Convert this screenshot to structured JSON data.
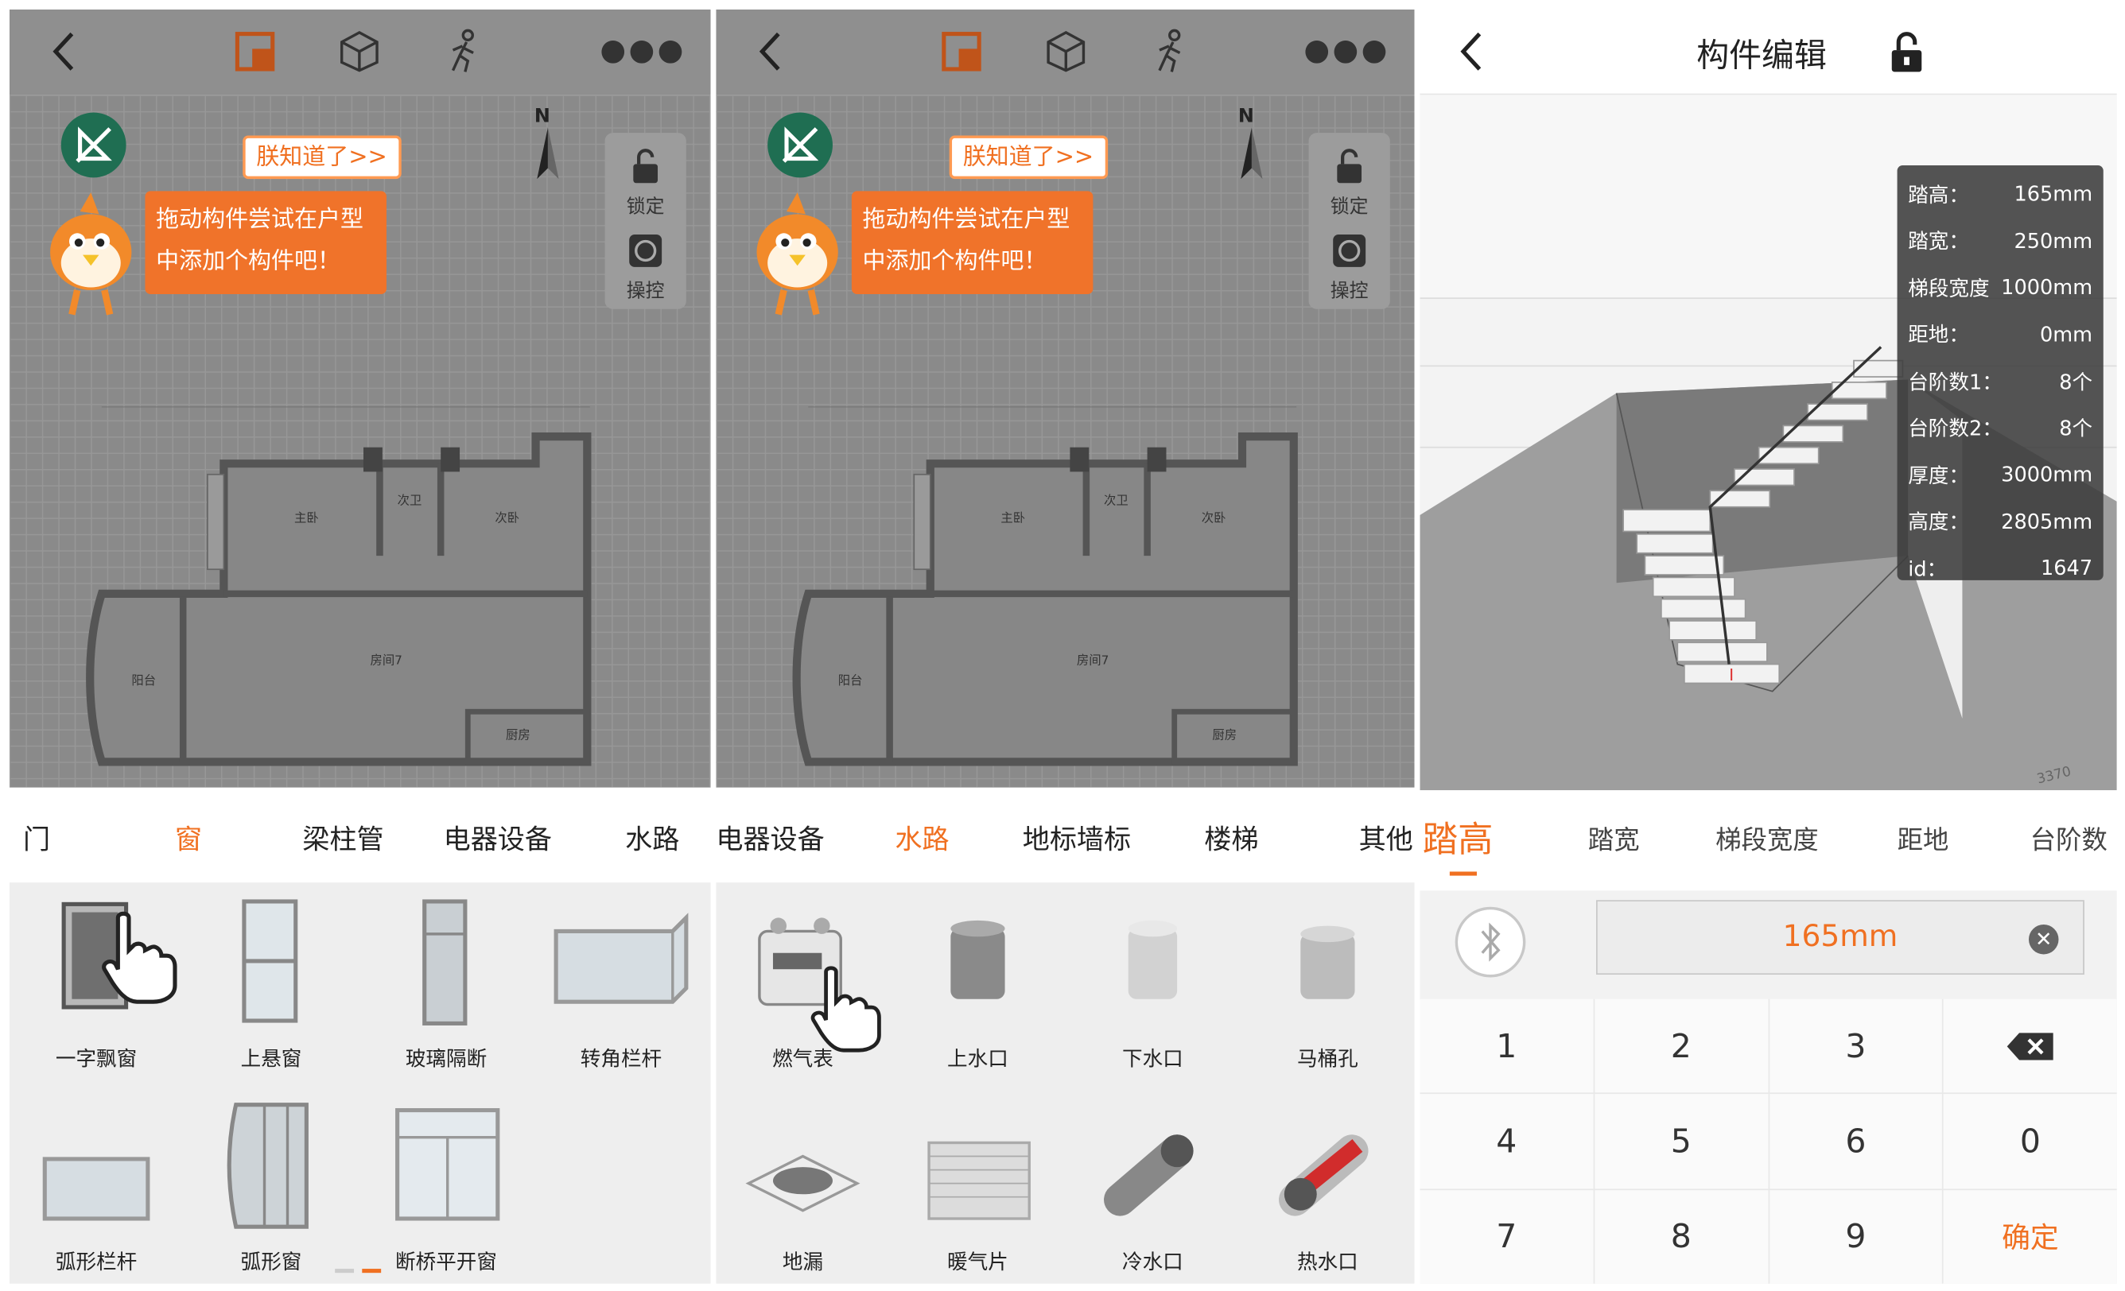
{
  "panel1": {
    "know": "朕知道了>>",
    "bubble": [
      "拖动构件尝试在户型",
      "中添加个构件吧！"
    ],
    "side": {
      "lock": "锁定",
      "control": "操控"
    },
    "north": "N",
    "plan_labels": {
      "master": "主卧",
      "guest_bath": "次卫",
      "guest_bed": "次卧",
      "room7": "房间7",
      "balcony": "阳台",
      "kitchen": "厨房"
    },
    "categories": [
      "门",
      "窗",
      "梁柱管",
      "电器设备",
      "水路"
    ],
    "active_category": "窗",
    "items": [
      "一字飘窗",
      "上悬窗",
      "玻璃隔断",
      "转角栏杆",
      "弧形栏杆",
      "弧形窗",
      "断桥平开窗"
    ]
  },
  "panel2": {
    "know": "朕知道了>>",
    "bubble": [
      "拖动构件尝试在户型",
      "中添加个构件吧！"
    ],
    "side": {
      "lock": "锁定",
      "control": "操控"
    },
    "north": "N",
    "plan_labels": {
      "master": "主卧",
      "guest_bath": "次卫",
      "guest_bed": "次卧",
      "room7": "房间7",
      "balcony": "阳台",
      "kitchen": "厨房"
    },
    "categories": [
      "电器设备",
      "水路",
      "地标墙标",
      "楼梯",
      "其他"
    ],
    "active_category": "水路",
    "items": [
      "燃气表",
      "上水口",
      "下水口",
      "马桶孔",
      "地漏",
      "暖气片",
      "冷水口",
      "热水口"
    ]
  },
  "panel3": {
    "title": "构件编辑",
    "info": [
      {
        "k": "踏高：",
        "v": "165mm"
      },
      {
        "k": "踏宽：",
        "v": "250mm"
      },
      {
        "k": "梯段宽度",
        "v": "1000mm"
      },
      {
        "k": "距地：",
        "v": "0mm"
      },
      {
        "k": "台阶数1：",
        "v": "8个"
      },
      {
        "k": "台阶数2：",
        "v": "8个"
      },
      {
        "k": "厚度：",
        "v": "3000mm"
      },
      {
        "k": "高度：",
        "v": "2805mm"
      },
      {
        "k": "id：",
        "v": "1647"
      }
    ],
    "tabs": [
      "踏高",
      "踏宽",
      "梯段宽度",
      "距地",
      "台阶数"
    ],
    "active_tab": "踏高",
    "value": "165mm",
    "keys": [
      "1",
      "2",
      "3",
      "⌫",
      "4",
      "5",
      "6",
      "0",
      "7",
      "8",
      "9",
      "确定"
    ],
    "scene_dim": "3370"
  },
  "colors": {
    "accent": "#f07021",
    "overlay": "#8f8f8f"
  }
}
